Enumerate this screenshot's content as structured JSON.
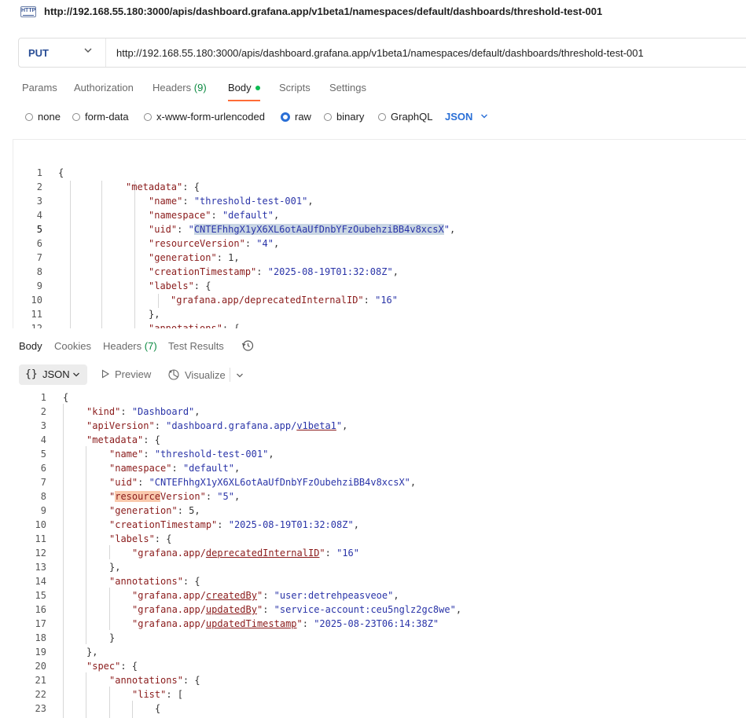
{
  "window": {
    "badge": "HTTP",
    "title": "http://192.168.55.180:3000/apis/dashboard.grafana.app/v1beta1/namespaces/default/dashboards/threshold-test-001"
  },
  "request": {
    "method": "PUT",
    "url": "http://192.168.55.180:3000/apis/dashboard.grafana.app/v1beta1/namespaces/default/dashboards/threshold-test-001",
    "tabs": [
      {
        "label": "Params"
      },
      {
        "label": "Authorization"
      },
      {
        "label": "Headers",
        "count": "(9)"
      },
      {
        "label": "Body",
        "active": true
      },
      {
        "label": "Scripts"
      },
      {
        "label": "Settings"
      }
    ],
    "body_types": [
      "none",
      "form-data",
      "x-www-form-urlencoded",
      "raw",
      "binary",
      "GraphQL"
    ],
    "selected_body_type": "raw",
    "format": "JSON",
    "editor_lines": [
      {
        "n": "1",
        "text": "{"
      },
      {
        "n": "2",
        "text": "\"metadata\": {"
      },
      {
        "n": "3",
        "text": "\"name\": \"threshold-test-001\","
      },
      {
        "n": "4",
        "text": "\"namespace\": \"default\","
      },
      {
        "n": "5",
        "text": "\"uid\": \"CNTEFhhgX1yX6XL6otAaUfDnbYFzOubehziBB4v8xcsX\","
      },
      {
        "n": "6",
        "text": "\"resourceVersion\": \"4\","
      },
      {
        "n": "7",
        "text": "\"generation\": 1,"
      },
      {
        "n": "8",
        "text": "\"creationTimestamp\": \"2025-08-19T01:32:08Z\","
      },
      {
        "n": "9",
        "text": "\"labels\": {"
      },
      {
        "n": "10",
        "text": "\"grafana.app/deprecatedInternalID\": \"16\""
      },
      {
        "n": "11",
        "text": "},"
      },
      {
        "n": "12",
        "text": "\"annotations\": {"
      }
    ]
  },
  "response": {
    "tabs": [
      {
        "label": "Body",
        "active": true
      },
      {
        "label": "Cookies"
      },
      {
        "label": "Headers",
        "count": "(7)"
      },
      {
        "label": "Test Results"
      }
    ],
    "history_icon": "history-icon",
    "toolbar": {
      "format": "JSON",
      "preview": "Preview",
      "visualize": "Visualize"
    },
    "editor_lines": [
      {
        "n": "1",
        "text": "{"
      },
      {
        "n": "2",
        "text": "\"kind\": \"Dashboard\","
      },
      {
        "n": "3",
        "text": "\"apiVersion\": \"dashboard.grafana.app/v1beta1\","
      },
      {
        "n": "4",
        "text": "\"metadata\": {"
      },
      {
        "n": "5",
        "text": "\"name\": \"threshold-test-001\","
      },
      {
        "n": "6",
        "text": "\"namespace\": \"default\","
      },
      {
        "n": "7",
        "text": "\"uid\": \"CNTEFhhgX1yX6XL6otAaUfDnbYFzOubehziBB4v8xcsX\","
      },
      {
        "n": "8",
        "text": "\"resourceVersion\": \"5\","
      },
      {
        "n": "9",
        "text": "\"generation\": 5,"
      },
      {
        "n": "10",
        "text": "\"creationTimestamp\": \"2025-08-19T01:32:08Z\","
      },
      {
        "n": "11",
        "text": "\"labels\": {"
      },
      {
        "n": "12",
        "text": "\"grafana.app/deprecatedInternalID\": \"16\""
      },
      {
        "n": "13",
        "text": "},"
      },
      {
        "n": "14",
        "text": "\"annotations\": {"
      },
      {
        "n": "15",
        "text": "\"grafana.app/createdBy\": \"user:detrehpeasveoe\","
      },
      {
        "n": "16",
        "text": "\"grafana.app/updatedBy\": \"service-account:ceu5nglz2gc8we\","
      },
      {
        "n": "17",
        "text": "\"grafana.app/updatedTimestamp\": \"2025-08-23T06:14:38Z\""
      },
      {
        "n": "18",
        "text": "}"
      },
      {
        "n": "19",
        "text": "},"
      },
      {
        "n": "20",
        "text": "\"spec\": {"
      },
      {
        "n": "21",
        "text": "\"annotations\": {"
      },
      {
        "n": "22",
        "text": "\"list\": ["
      },
      {
        "n": "23",
        "text": "{"
      }
    ]
  },
  "colors": {
    "accent": "#ff6c37",
    "active_dot": "#0cbb52",
    "link": "#2a6fd6",
    "method": "#2a4e96",
    "json_key": "#8a1b1b",
    "json_string": "#2a34a8"
  }
}
